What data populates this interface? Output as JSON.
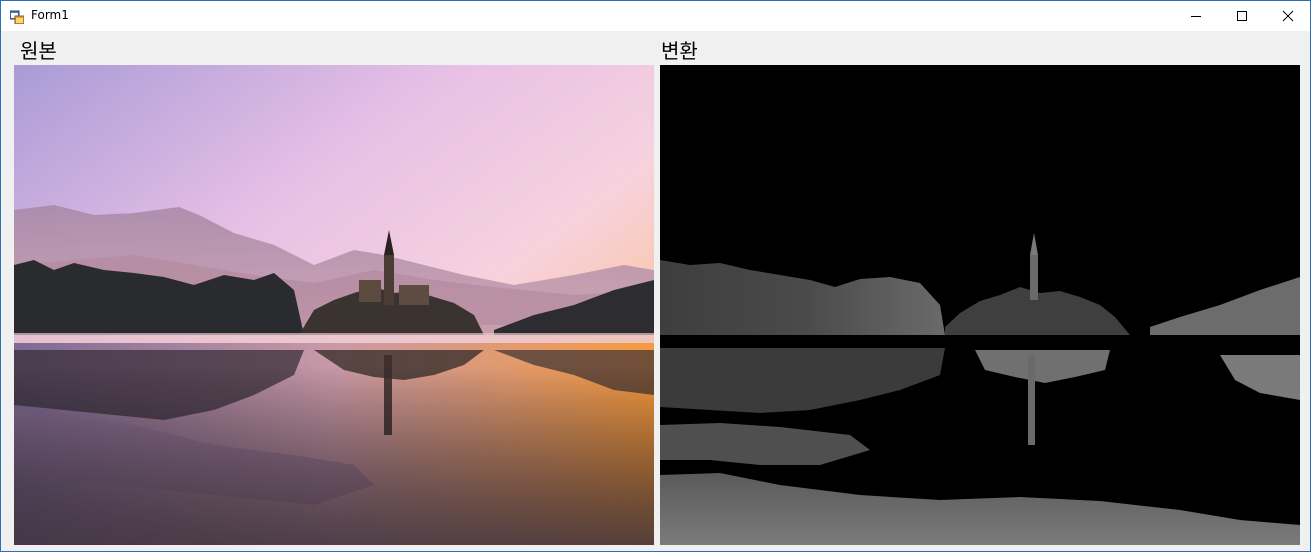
{
  "window": {
    "title": "Form1",
    "app_icon": "winforms-app-icon",
    "controls": {
      "minimize_icon": "minimize-icon",
      "maximize_icon": "maximize-icon",
      "close_icon": "close-icon"
    }
  },
  "labels": {
    "original": "원본",
    "converted": "변환"
  },
  "pictures": {
    "original": {
      "description_icon": "photo-icon"
    },
    "converted": {
      "description_icon": "photo-icon"
    }
  },
  "colors": {
    "title_border": "#2b6fb6",
    "form_background": "#f0f0f0",
    "sky_top": "#a99bd6",
    "sky_mid": "#f3c7e3",
    "sky_horizon": "#f8a64a",
    "converted_background": "#000000"
  }
}
